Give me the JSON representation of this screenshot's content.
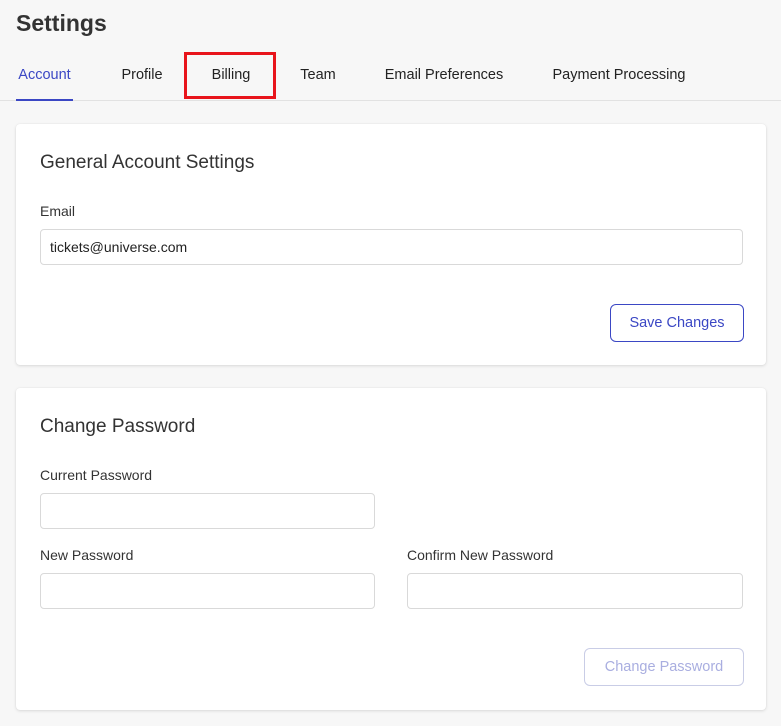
{
  "header": {
    "title": "Settings"
  },
  "tabs": [
    {
      "label": "Account",
      "active": true
    },
    {
      "label": "Profile",
      "active": false
    },
    {
      "label": "Billing",
      "active": false,
      "highlighted": true
    },
    {
      "label": "Team",
      "active": false
    },
    {
      "label": "Email Preferences",
      "active": false
    },
    {
      "label": "Payment Processing",
      "active": false
    }
  ],
  "general_settings": {
    "title": "General Account Settings",
    "email_label": "Email",
    "email_value": "tickets@universe.com",
    "save_label": "Save Changes"
  },
  "change_password": {
    "title": "Change Password",
    "current_label": "Current Password",
    "new_label": "New Password",
    "confirm_label": "Confirm New Password",
    "submit_label": "Change Password",
    "submit_disabled": true
  },
  "colors": {
    "accent": "#3b47c4",
    "highlight": "#e8141b",
    "background": "#f7f7f7"
  }
}
